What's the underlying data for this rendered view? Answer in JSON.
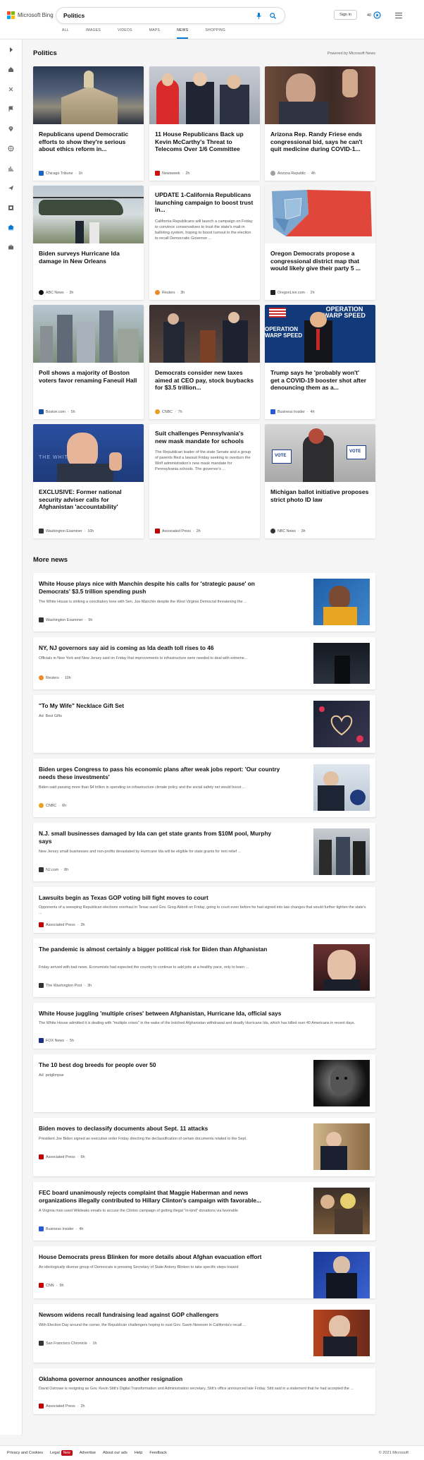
{
  "header": {
    "brand": "Microsoft Bing",
    "query": "Politics",
    "signin": "Sign in",
    "points": "40",
    "tabs": [
      {
        "label": "ALL"
      },
      {
        "label": "IMAGES"
      },
      {
        "label": "VIDEOS"
      },
      {
        "label": "MAPS"
      },
      {
        "label": "NEWS"
      },
      {
        "label": "SHOPPING"
      }
    ],
    "active_tab": "NEWS"
  },
  "sidebar": {
    "icons": [
      "expand-icon",
      "home-icon",
      "compass-icon",
      "flag-icon",
      "location-icon",
      "globe-icon",
      "chart-icon",
      "plane-icon",
      "grid-icon",
      "bank-icon",
      "briefcase-icon"
    ]
  },
  "section": {
    "title": "Politics",
    "powered": "Powered by Microsoft News"
  },
  "cards": [
    {
      "title": "Republicans upend Democratic efforts to show they're serious about ethics reform in...",
      "source": "Chicago Tribune",
      "age": "1h",
      "fav": "#1a66c2"
    },
    {
      "title": "11 House Republicans Back up Kevin McCarthy's Threat to Telecoms Over 1/6 Committee",
      "source": "Newsweek",
      "age": "2h",
      "fav": "#d01010"
    },
    {
      "title": "Arizona Rep. Randy Friese ends congressional bid, says he can't quit medicine during COVID-1...",
      "source": "Arizona Republic",
      "age": "4h",
      "fav": "#a0a0a0"
    },
    {
      "title": "Biden surveys Hurricane Ida damage in New Orleans",
      "source": "ABC News",
      "age": "3h",
      "fav": "#111111"
    },
    {
      "title": "UPDATE 1-California Republicans launching campaign to boost trust in...",
      "snippet": "California Republicans will launch a campaign on Friday to convince conservatives to trust the state's mail-in balloting system, hoping to boost turnout in the election to recall Democratic Governor ...",
      "source": "Reuters",
      "age": "3h",
      "fav": "#f08a24"
    },
    {
      "title": "Oregon Democrats propose a congressional district map that would likely give their party 5 ...",
      "source": "OregonLive.com",
      "age": "2h",
      "fav": "#222222"
    },
    {
      "title": "Poll shows a majority of Boston voters favor renaming Faneuil Hall",
      "source": "Boston.com",
      "age": "5h",
      "fav": "#1a4fa0"
    },
    {
      "title": "Democrats consider new taxes aimed at CEO pay, stock buybacks for $3.5 trillion...",
      "source": "CNBC",
      "age": "7h",
      "fav": "#e8a020"
    },
    {
      "title": "Trump says he 'probably won't' get a COVID-19 booster shot after denouncing them as a...",
      "source": "Business Insider",
      "age": "4h",
      "fav": "#2a5bd7"
    },
    {
      "title": "EXCLUSIVE: Former national security adviser calls for Afghanistan 'accountability'",
      "source": "Washington Examiner",
      "age": "10h",
      "fav": "#333333"
    },
    {
      "title": "Suit challenges Pennsylvania's new mask mandate for schools",
      "snippet": "The Republican leader of the state Senate and a group of parents filed a lawsuit Friday seeking to overturn the Wolf administration's new mask mandate for Pennsylvania schools. The governor's ...",
      "source": "Associated Press",
      "age": "2h",
      "fav": "#c00000"
    },
    {
      "title": "Michigan ballot initiative proposes strict photo ID law",
      "source": "NBC News",
      "age": "3h",
      "fav": "#333333"
    }
  ],
  "image_captions": {
    "operation_banner": "OPERATION WARP SPEED",
    "poster_text": "THE WHITE HOUSE",
    "vote_sign": "VOTE"
  },
  "more": {
    "title": "More news",
    "items": [
      {
        "title": "White House plays nice with Manchin despite his calls for 'strategic pause' on Democrats' $3.5 trillion spending push",
        "snippet": "The White House is striking a conciliatory tone with Sen. Joe Manchin despite the West Virginia Democrat threatening the ...",
        "source": "Washington Examiner",
        "age": "5h",
        "fav": "#333333"
      },
      {
        "title": "NY, NJ governors say aid is coming as Ida death toll rises to 46",
        "snippet": "Officials in New York and New Jersey said on Friday that improvements to infrastructure were needed to deal with extreme...",
        "source": "Reuters",
        "age": "10h",
        "fav": "#f08a24"
      },
      {
        "title": "\"To My Wife\" Necklace Gift Set",
        "ad": "Ad",
        "source": "Best Gifts"
      },
      {
        "title": "Biden urges Congress to pass his economic plans after weak jobs report: 'Our country needs these investments'",
        "snippet": "Biden said passing more than $4 trillion in spending on infrastructure climate policy and the social safety net would boost ...",
        "source": "CNBC",
        "age": "6h",
        "fav": "#e8a020"
      },
      {
        "title": "N.J. small businesses damaged by Ida can get state grants from $10M pool, Murphy says",
        "snippet": "New Jersey small businesses and non-profits devastated by Hurricane Ida will be eligible for state grants for rent relief ...",
        "source": "NJ.com",
        "age": "8h",
        "fav": "#333333"
      },
      {
        "title": "Lawsuits begin as Texas GOP voting bill fight moves to court",
        "snippet": "Opponents of a sweeping Republican elections overhaul in Texas sued Gov. Greg Abbott on Friday, going to court even before he had signed into law changes that would further tighten the state's ...",
        "source": "Associated Press",
        "age": "3h",
        "fav": "#c00000"
      },
      {
        "title": "The pandemic is almost certainly a bigger political risk for Biden than Afghanistan",
        "snippet": "Friday arrived with bad news. Economists had expected the country to continue to add jobs at a healthy pace, only to learn ...",
        "source": "The Washington Post",
        "age": "3h",
        "fav": "#333333"
      },
      {
        "title": "White House juggling 'multiple crises' between Afghanistan, Hurricane Ida, official says",
        "snippet": "The White House admitted it is dealing with \"multiple crises\" in the wake of the botched Afghanistan withdrawal and deadly Hurricane Ida, which has killed over 40 Americans in recent days.",
        "source": "FOX News",
        "age": "5h",
        "fav": "#1a2f80"
      },
      {
        "title": "The 10 best dog breeds for people over 50",
        "ad": "Ad",
        "source": "petglimpse"
      },
      {
        "title": "Biden moves to declassify documents about Sept. 11 attacks",
        "snippet": "President Joe Biden signed an executive order Friday directing the declassification of certain documents related to the Sept.",
        "source": "Associated Press",
        "age": "6h",
        "fav": "#c00000"
      },
      {
        "title": "FEC board unanimously rejects complaint that Maggie Haberman and news organizations illegally contributed to Hillary Clinton's campaign with favorable...",
        "snippet": "A Virginia man used Wikileaks emails to accuse the Clinton campaign of getting illegal \"in-kind\" donations via favorable",
        "source": "Business Insider",
        "age": "4h",
        "fav": "#2a5bd7"
      },
      {
        "title": "House Democrats press Blinken for more details about Afghan evacuation effort",
        "snippet": "An ideologically diverse group of Democrats is pressing Secretary of State Antony Blinken to take specific steps toward",
        "source": "CNN",
        "age": "9h",
        "fav": "#cc0000"
      },
      {
        "title": "Newsom widens recall fundraising lead against GOP challengers",
        "snippet": "With Election Day around the corner, the Republican challengers hoping to oust Gov. Gavin Newsom in California's recall ...",
        "source": "San Francisco Chronicle",
        "age": "1h",
        "fav": "#333333"
      },
      {
        "title": "Oklahoma governor announces another resignation",
        "snippet": "David Ostrowe is resigning as Gov. Kevin Stitt's Digital Transformation and Administration secretary, Stitt's office announced late Friday. Stitt said in a statement that he had accepted the ...",
        "source": "Associated Press",
        "age": "2h",
        "fav": "#c00000"
      }
    ]
  },
  "footer": {
    "links": [
      "Privacy and Cookies",
      "Legal",
      "Advertise",
      "About our ads",
      "Help",
      "Feedback"
    ],
    "new_badge": "New",
    "copyright": "© 2021 Microsoft"
  }
}
